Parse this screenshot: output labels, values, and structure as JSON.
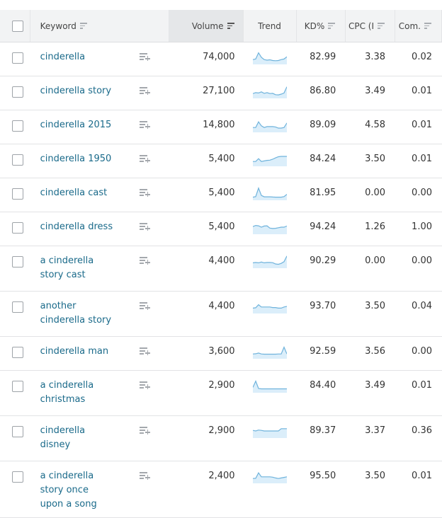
{
  "header": {
    "keyword": "Keyword",
    "volume": "Volume",
    "trend": "Trend",
    "kd": "KD%",
    "cpc": "CPC (I",
    "com": "Com."
  },
  "sorted_column": "volume",
  "colors": {
    "link": "#1a6a8a",
    "spark_line": "#6fb3dc",
    "spark_fill": "#dbeefa"
  },
  "rows": [
    {
      "keyword": [
        "cinderella"
      ],
      "volume": "74,000",
      "kd": "82.99",
      "cpc": "3.38",
      "com": "0.02",
      "trend": [
        0.3,
        0.35,
        0.9,
        0.5,
        0.3,
        0.25,
        0.28,
        0.22,
        0.2,
        0.22,
        0.3,
        0.35,
        0.55
      ]
    },
    {
      "keyword": [
        "cinderella story"
      ],
      "volume": "27,100",
      "kd": "86.80",
      "cpc": "3.49",
      "com": "0.01",
      "trend": [
        0.3,
        0.38,
        0.35,
        0.45,
        0.32,
        0.38,
        0.3,
        0.32,
        0.2,
        0.18,
        0.25,
        0.35,
        0.9
      ]
    },
    {
      "keyword": [
        "cinderella 2015"
      ],
      "volume": "14,800",
      "kd": "89.09",
      "cpc": "4.58",
      "com": "0.01",
      "trend": [
        0.3,
        0.3,
        0.8,
        0.45,
        0.3,
        0.38,
        0.38,
        0.38,
        0.35,
        0.25,
        0.25,
        0.3,
        0.7
      ]
    },
    {
      "keyword": [
        "cinderella 1950"
      ],
      "volume": "5,400",
      "kd": "84.24",
      "cpc": "3.50",
      "com": "0.01",
      "trend": [
        0.3,
        0.3,
        0.55,
        0.3,
        0.35,
        0.4,
        0.42,
        0.5,
        0.62,
        0.72,
        0.75,
        0.75,
        0.75
      ]
    },
    {
      "keyword": [
        "cinderella cast"
      ],
      "volume": "5,400",
      "kd": "81.95",
      "cpc": "0.00",
      "com": "0.00",
      "trend": [
        0.15,
        0.2,
        0.95,
        0.3,
        0.18,
        0.18,
        0.18,
        0.16,
        0.15,
        0.15,
        0.15,
        0.2,
        0.4
      ]
    },
    {
      "keyword": [
        "cinderella dress"
      ],
      "volume": "5,400",
      "kd": "94.24",
      "cpc": "1.26",
      "com": "1.00",
      "trend": [
        0.55,
        0.65,
        0.62,
        0.5,
        0.6,
        0.62,
        0.42,
        0.38,
        0.4,
        0.45,
        0.5,
        0.5,
        0.6
      ]
    },
    {
      "keyword": [
        "a cinderella",
        "story cast"
      ],
      "volume": "4,400",
      "kd": "90.29",
      "cpc": "0.00",
      "com": "0.00",
      "trend": [
        0.35,
        0.38,
        0.35,
        0.42,
        0.35,
        0.38,
        0.38,
        0.36,
        0.25,
        0.22,
        0.3,
        0.45,
        0.95
      ]
    },
    {
      "keyword": [
        "another",
        "cinderella story"
      ],
      "volume": "4,400",
      "kd": "93.70",
      "cpc": "3.50",
      "com": "0.04",
      "trend": [
        0.35,
        0.38,
        0.65,
        0.45,
        0.45,
        0.45,
        0.45,
        0.4,
        0.4,
        0.35,
        0.35,
        0.45,
        0.5
      ]
    },
    {
      "keyword": [
        "cinderella man"
      ],
      "volume": "3,600",
      "kd": "92.59",
      "cpc": "3.56",
      "com": "0.00",
      "trend": [
        0.3,
        0.32,
        0.38,
        0.3,
        0.28,
        0.28,
        0.28,
        0.28,
        0.28,
        0.3,
        0.3,
        0.9,
        0.3
      ]
    },
    {
      "keyword": [
        "a cinderella",
        "christmas"
      ],
      "volume": "2,900",
      "kd": "84.40",
      "cpc": "3.49",
      "com": "0.01",
      "trend": [
        0.35,
        0.9,
        0.25,
        0.22,
        0.22,
        0.22,
        0.22,
        0.22,
        0.22,
        0.22,
        0.22,
        0.22,
        0.22
      ]
    },
    {
      "keyword": [
        "cinderella",
        "disney"
      ],
      "volume": "2,900",
      "kd": "89.37",
      "cpc": "3.37",
      "com": "0.36",
      "trend": [
        0.55,
        0.5,
        0.58,
        0.55,
        0.5,
        0.5,
        0.5,
        0.5,
        0.5,
        0.5,
        0.7,
        0.7,
        0.7
      ]
    },
    {
      "keyword": [
        "a cinderella",
        "story once",
        "upon a song"
      ],
      "volume": "2,400",
      "kd": "95.50",
      "cpc": "3.50",
      "com": "0.01",
      "trend": [
        0.3,
        0.32,
        0.8,
        0.45,
        0.45,
        0.45,
        0.45,
        0.42,
        0.35,
        0.3,
        0.35,
        0.4,
        0.45
      ]
    }
  ]
}
